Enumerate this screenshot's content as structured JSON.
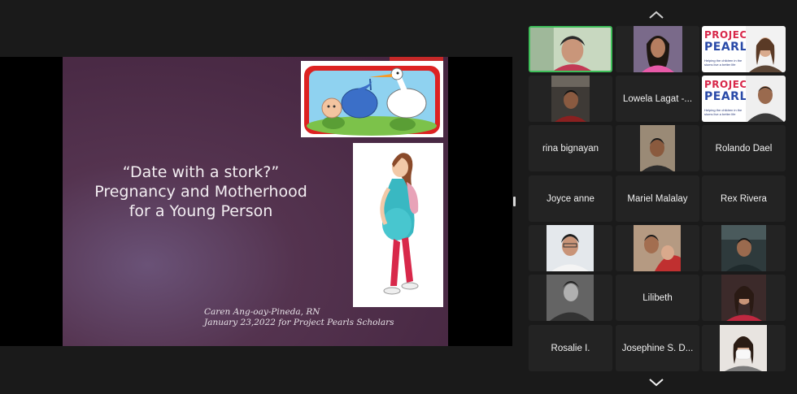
{
  "slide": {
    "title_lines": [
      "“Date with a stork?”",
      "Pregnancy and  Motherhood",
      "for a Young Person"
    ],
    "author_lines": [
      "Caren Ang-oay-Pineda, RN",
      "January 23,2022 for Project Pearls Scholars"
    ]
  },
  "gallery": {
    "tiles": [
      {
        "label": "",
        "type": "video",
        "active": true
      },
      {
        "label": "",
        "type": "video"
      },
      {
        "label": "",
        "type": "video-logo"
      },
      {
        "label": "",
        "type": "video"
      },
      {
        "label": "Lowela Lagat -...",
        "type": "name"
      },
      {
        "label": "",
        "type": "video-logo"
      },
      {
        "label": "rina bignayan",
        "type": "name"
      },
      {
        "label": "",
        "type": "video"
      },
      {
        "label": "Rolando Dael",
        "type": "name"
      },
      {
        "label": "Joyce anne",
        "type": "name"
      },
      {
        "label": "Mariel Malalay",
        "type": "name"
      },
      {
        "label": "Rex Rivera",
        "type": "name"
      },
      {
        "label": "",
        "type": "video"
      },
      {
        "label": "",
        "type": "video"
      },
      {
        "label": "",
        "type": "video"
      },
      {
        "label": "",
        "type": "video"
      },
      {
        "label": "Lilibeth",
        "type": "name"
      },
      {
        "label": "",
        "type": "video"
      },
      {
        "label": "Rosalie I.",
        "type": "name"
      },
      {
        "label": "Josephine S. D...",
        "type": "name"
      },
      {
        "label": "",
        "type": "video"
      }
    ]
  },
  "logo": {
    "line1": "PROJECT",
    "line2": "PEARLS",
    "tagline": "Helping the children in the slums live a better life"
  },
  "icons": {
    "scroll_up": "chevron-up-icon",
    "scroll_down": "chevron-down-icon"
  },
  "colors": {
    "active_speaker_border": "#3fbf5a",
    "tile_background": "#232323",
    "slide_background": "#4a2a45"
  }
}
